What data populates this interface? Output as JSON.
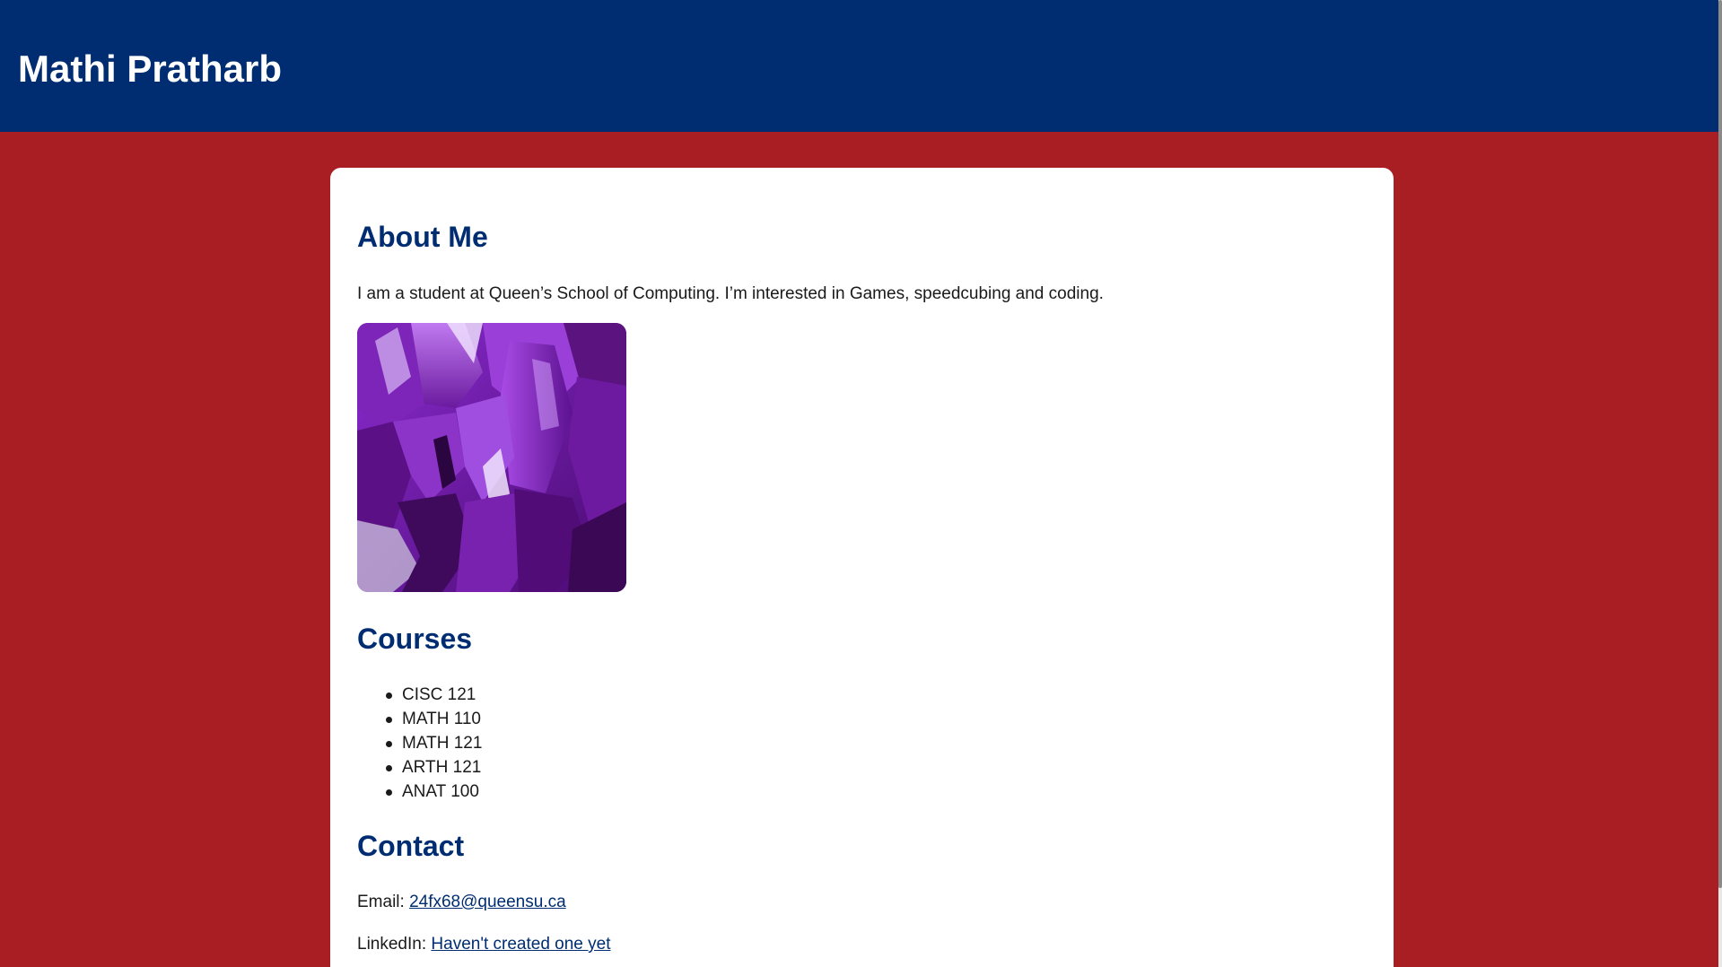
{
  "header": {
    "title": "Mathi Pratharb"
  },
  "about": {
    "heading": "About Me",
    "text": "I am a student at Queen’s School of Computing. I’m interested in Games, speedcubing and coding.",
    "image_subject": "amethyst crystals"
  },
  "courses": {
    "heading": "Courses",
    "items": [
      "CISC 121",
      "MATH 110",
      "MATH 121",
      "ARTH 121",
      "ANAT 100"
    ]
  },
  "contact": {
    "heading": "Contact",
    "email_label": "Email:",
    "email_link": "24fx68@queensu.ca",
    "linkedin_label": "LinkedIn:",
    "linkedin_link": "Haven't created one yet"
  },
  "colors": {
    "header_bg": "#002d72",
    "page_bg": "#a91e22",
    "heading_text": "#002d72",
    "card_bg": "#ffffff"
  }
}
